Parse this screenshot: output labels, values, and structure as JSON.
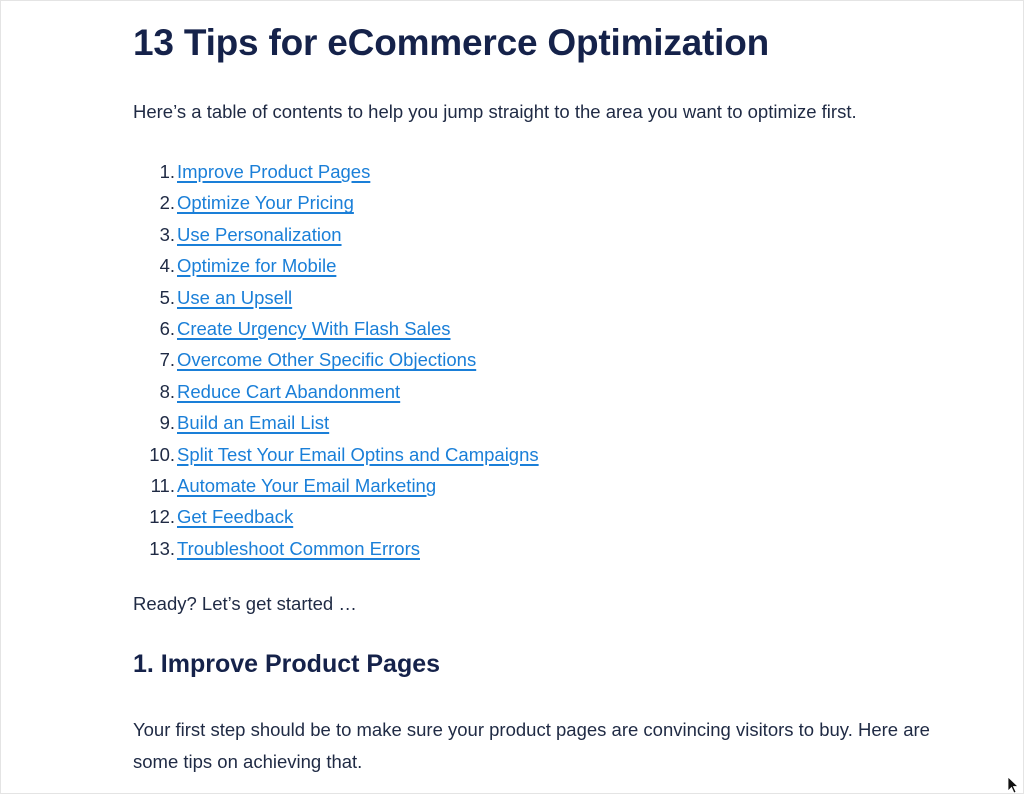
{
  "page": {
    "title": "13 Tips for eCommerce Optimization",
    "intro": "Here’s a table of contents to help you jump straight to the area you want to optimize first.",
    "toc": [
      {
        "num": "1.",
        "label": "Improve Product Pages"
      },
      {
        "num": "2.",
        "label": "Optimize Your Pricing"
      },
      {
        "num": "3.",
        "label": "Use Personalization"
      },
      {
        "num": "4.",
        "label": "Optimize for Mobile"
      },
      {
        "num": "5.",
        "label": "Use an Upsell"
      },
      {
        "num": "6.",
        "label": "Create Urgency With Flash Sales"
      },
      {
        "num": "7.",
        "label": "Overcome Other Specific Objections"
      },
      {
        "num": "8.",
        "label": "Reduce Cart Abandonment"
      },
      {
        "num": "9.",
        "label": "Build an Email List"
      },
      {
        "num": "10.",
        "label": "Split Test Your Email Optins and Campaigns"
      },
      {
        "num": "11.",
        "label": "Automate Your Email Marketing"
      },
      {
        "num": "12.",
        "label": "Get Feedback"
      },
      {
        "num": "13.",
        "label": "Troubleshoot Common Errors"
      }
    ],
    "ready_text": "Ready? Let’s get started …",
    "section_heading": "1. Improve Product Pages",
    "section_body": "Your first step should be to make sure your product pages are convincing visitors to buy. Here are some tips on achieving that."
  },
  "colors": {
    "heading": "#15224a",
    "body_text": "#1f2a44",
    "link": "#1a7fd8"
  },
  "cursor": {
    "icon": "mouse-pointer-icon"
  }
}
